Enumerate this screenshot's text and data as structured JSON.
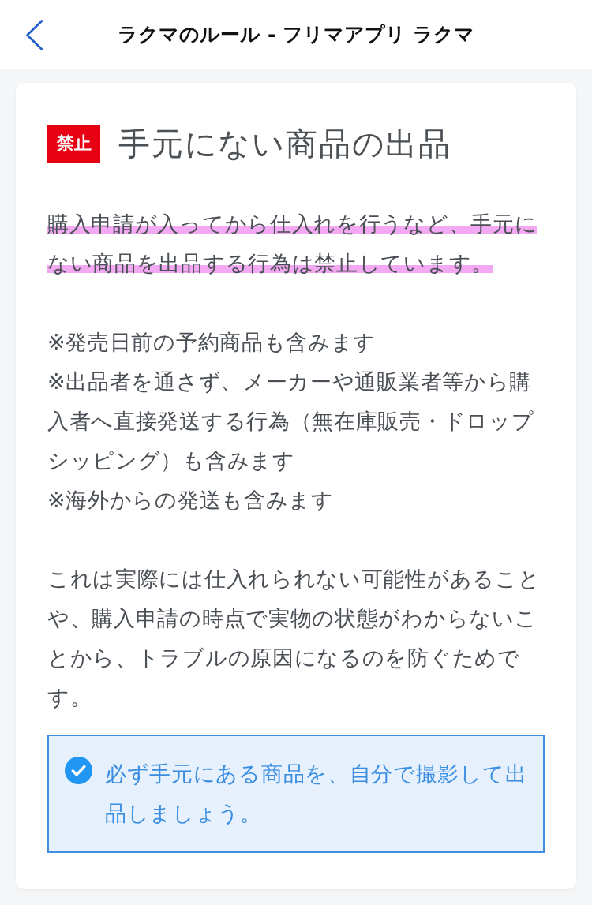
{
  "header": {
    "title": "ラクマのルール - フリマアプリ ラクマ"
  },
  "rule": {
    "badge": "禁止",
    "title": "手元にない商品の出品"
  },
  "sections": [
    {
      "kind": "paragraph",
      "text": "購入申請が入ってから仕入れを行うなど、手元にない商品を出品する行為は禁止しています。",
      "highlighted": true
    },
    {
      "kind": "notes",
      "items": [
        "※発売日前の予約商品も含みます",
        "※出品者を通さず、メーカーや通販業者等から購入者へ直接発送する行為（無在庫販売・ドロップシッピング）も含みます",
        "※海外からの発送も含みます"
      ]
    },
    {
      "kind": "paragraph",
      "text": "これは実際には仕入れられない可能性があることや、購入申請の時点で実物の状態がわからないことから、トラブルの原因になるのを防ぐためです。",
      "highlighted": false
    }
  ],
  "tip": {
    "text": "必ず手元にある商品を、自分で撮影して出品しましょう。"
  }
}
